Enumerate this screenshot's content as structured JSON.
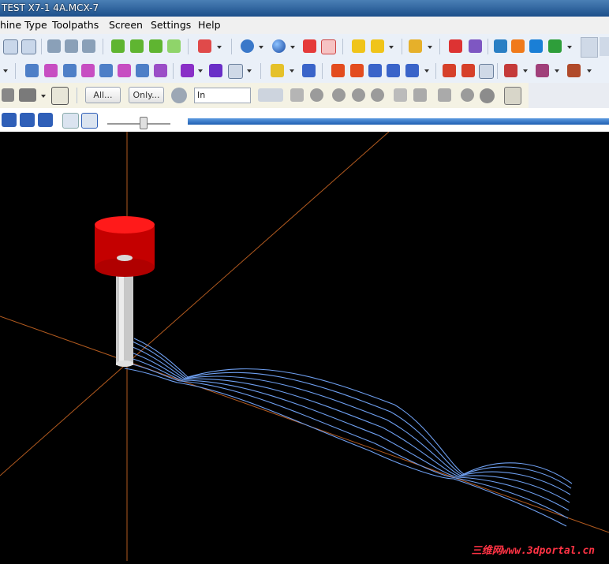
{
  "window": {
    "title": "TEST X7-1 4A.MCX-7"
  },
  "menu": {
    "items": [
      "hine Type",
      "Toolpaths",
      "Screen",
      "Settings",
      "Help"
    ]
  },
  "toolbar3": {
    "all_label": "All...",
    "only_label": "Only...",
    "level_select": "In"
  },
  "watermark": "三维网www.3dportal.cn",
  "colors": {
    "axis": "#b25a1f",
    "toolpath": "#6e9ff0",
    "holder": "#d40000",
    "shank": "#c8c8c8",
    "background": "#000000"
  }
}
